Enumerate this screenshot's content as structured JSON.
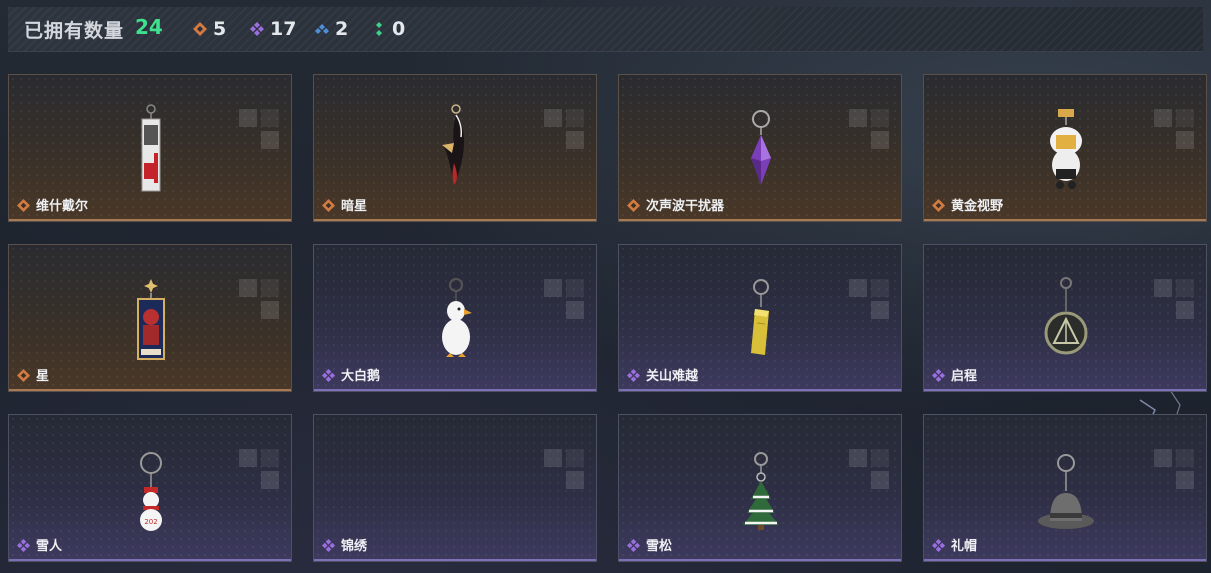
{
  "header": {
    "owned_label": "已拥有数量",
    "owned_count": "24",
    "stats": [
      {
        "icon": "orange-diamond-icon",
        "color": "#d27a3f",
        "value": "5"
      },
      {
        "icon": "purple-diamond-icon",
        "color": "#9b6fe0",
        "value": "17"
      },
      {
        "icon": "blue-diamond-icon",
        "color": "#4f8fd8",
        "value": "2"
      },
      {
        "icon": "green-dots-icon",
        "color": "#3fd08a",
        "value": "0"
      }
    ]
  },
  "rarity_colors": {
    "orange": "#d27a3f",
    "purple": "#9b6fe0"
  },
  "items": [
    {
      "name": "维什戴尔",
      "rarity": "orange",
      "art": "card-charm"
    },
    {
      "name": "暗星",
      "rarity": "orange",
      "art": "dark-star-charm"
    },
    {
      "name": "次声波干扰器",
      "rarity": "orange",
      "art": "purple-crystal-charm"
    },
    {
      "name": "黄金视野",
      "rarity": "orange",
      "art": "golden-figure-charm"
    },
    {
      "name": "星",
      "rarity": "orange",
      "art": "star-card-charm"
    },
    {
      "name": "大白鹅",
      "rarity": "purple",
      "art": "white-goose-charm"
    },
    {
      "name": "关山难越",
      "rarity": "purple",
      "art": "gold-bar-charm"
    },
    {
      "name": "启程",
      "rarity": "purple",
      "art": "medal-charm"
    },
    {
      "name": "雪人",
      "rarity": "purple",
      "art": "snowman-charm"
    },
    {
      "name": "锦绣",
      "rarity": "purple",
      "art": "empty"
    },
    {
      "name": "雪松",
      "rarity": "purple",
      "art": "snow-pine-charm"
    },
    {
      "name": "礼帽",
      "rarity": "purple",
      "art": "fedora-hat-charm"
    }
  ]
}
